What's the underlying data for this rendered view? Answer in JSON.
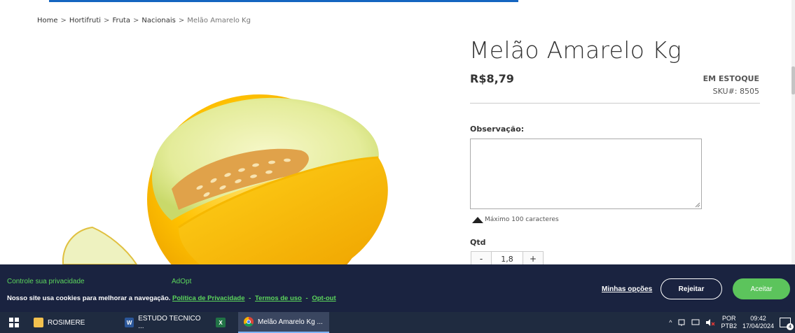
{
  "breadcrumb": {
    "items": [
      "Home",
      "Hortifruti",
      "Fruta",
      "Nacionais"
    ],
    "separator": ">",
    "current": "Melão Amarelo Kg"
  },
  "product": {
    "title": "Melão Amarelo Kg",
    "price": "R$8,79",
    "stock_status": "EM ESTOQUE",
    "sku_label": "SKU#:",
    "sku": "8505",
    "image_icon": "yellow-melon-photo"
  },
  "observation": {
    "label": "Observação:",
    "value": "",
    "max_note": "Máximo 100 caracteres"
  },
  "quantity": {
    "label": "Qtd",
    "minus": "-",
    "value": "1,8",
    "plus": "+"
  },
  "cookie_banner": {
    "title": "Controle sua privacidade",
    "brand": "AdOpt",
    "text": "Nosso site usa cookies para melhorar a navegação.",
    "privacy_link": "Política de Privacidade",
    "terms_link": "Termos de uso",
    "optout_link": "Opt-out",
    "separator": "-",
    "my_options": "Minhas opções",
    "reject": "Rejeitar",
    "accept": "Aceitar",
    "accent_color": "#5cd65c",
    "background_color": "#1a2340"
  },
  "taskbar": {
    "items": [
      {
        "label": "ROSIMERE",
        "icon": "folder-icon"
      },
      {
        "label": "ESTUDO TECNICO ...",
        "icon": "word-icon"
      },
      {
        "label": "",
        "icon": "excel-icon"
      },
      {
        "label": "Melão Amarelo Kg ...",
        "icon": "chrome-icon"
      }
    ],
    "language": "POR",
    "layout": "PTB2",
    "time": "09:42",
    "date": "17/04/2024",
    "notification_count": "4"
  }
}
